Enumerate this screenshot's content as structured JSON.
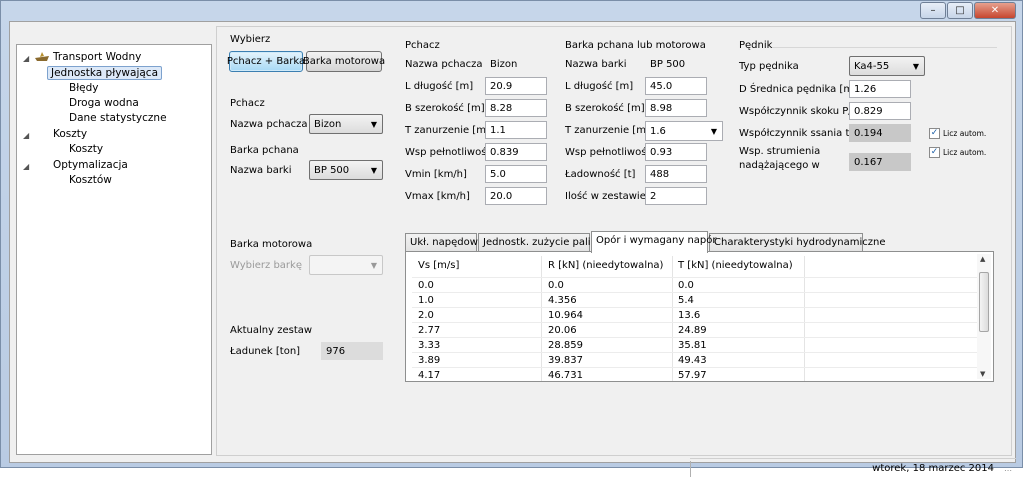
{
  "window": {
    "minimize_icon": "minimize-icon",
    "maximize_icon": "maximize-icon",
    "close_icon": "close-icon"
  },
  "tree": {
    "items": [
      {
        "label": "Transport Wodny",
        "level": 0,
        "expanded": true,
        "icon": "boat-icon"
      },
      {
        "label": "Jednostka pływająca",
        "level": 1,
        "selected": true
      },
      {
        "label": "Błędy",
        "level": 1
      },
      {
        "label": "Droga wodna",
        "level": 1
      },
      {
        "label": "Dane statystyczne",
        "level": 1
      },
      {
        "label": "Koszty",
        "level": 0,
        "expanded": true
      },
      {
        "label": "Koszty",
        "level": 1
      },
      {
        "label": "Optymalizacja",
        "level": 0,
        "expanded": true
      },
      {
        "label": "Kosztów",
        "level": 1
      }
    ]
  },
  "wybierz": {
    "title": "Wybierz",
    "btn_pchacz_barka": "Pchacz + Barka",
    "btn_barka_motorowa": "Barka motorowa"
  },
  "pchacz_select": {
    "title": "Pchacz",
    "label": "Nazwa pchacza",
    "value": "Bizon"
  },
  "barka_pchana_select": {
    "title": "Barka pchana",
    "label": "Nazwa barki",
    "value": "BP 500"
  },
  "barka_motorowa": {
    "title": "Barka motorowa",
    "placeholder": "Wybierz barkę",
    "value": ""
  },
  "aktualny_zestaw": {
    "title": "Aktualny zestaw",
    "label": "Ładunek [ton]",
    "value": "976"
  },
  "pchacz": {
    "title": "Pchacz",
    "fields": [
      {
        "label": "Nazwa pchacza",
        "value": "Bizon"
      },
      {
        "label": "L długość [m]",
        "value": "20.9"
      },
      {
        "label": "B szerokość [m]",
        "value": "8.28"
      },
      {
        "label": "T zanurzenie [m]",
        "value": "1.1"
      },
      {
        "label": "Wsp pełnotliwości",
        "value": "0.839"
      },
      {
        "label": "Vmin [km/h]",
        "value": "5.0"
      },
      {
        "label": "Vmax [km/h]",
        "value": "20.0"
      }
    ]
  },
  "barka": {
    "title": "Barka pchana lub motorowa",
    "fields": [
      {
        "label": "Nazwa barki",
        "value": "BP 500"
      },
      {
        "label": "L długość [m]",
        "value": "45.0"
      },
      {
        "label": "B szerokość [m]",
        "value": "8.98"
      },
      {
        "label": "T zanurzenie [m]",
        "value": "1.6"
      },
      {
        "label": "Wsp pełnotliwości",
        "value": "0.93"
      },
      {
        "label": "Ładowność [t]",
        "value": "488"
      },
      {
        "label": "Ilość w zestawie",
        "value": "2"
      }
    ]
  },
  "pednik": {
    "title": "Pędnik",
    "typ_label": "Typ pędnika",
    "typ_value": "Ka4-55",
    "srednica_label": "D Średnica pędnika [m]",
    "srednica_value": "1.26",
    "skok_label": "Współczynnik skoku P/D",
    "skok_value": "0.829",
    "ssania_label": "Współczynnik ssania t",
    "ssania_value": "0.194",
    "strum_label_1": "Wsp. strumienia",
    "strum_label_2": "nadążającego w",
    "strum_value": "0.167",
    "licz_autom": "Licz autom.",
    "licz_autom_1_checked": true,
    "licz_autom_2_checked": true
  },
  "tabs": [
    {
      "label": "Ukł. napędowy"
    },
    {
      "label": "Jednostk. zużycie paliwa"
    },
    {
      "label": "Opór i wymagany napór",
      "active": true
    },
    {
      "label": "Charakterystyki hydrodynamiczne"
    }
  ],
  "table": {
    "headers": [
      "Vs [m/s]",
      "R [kN] (nieedytowalna)",
      "T [kN] (nieedytowalna)"
    ],
    "rows": [
      [
        "0.0",
        "0.0",
        "0.0"
      ],
      [
        "1.0",
        "4.356",
        "5.4"
      ],
      [
        "2.0",
        "10.964",
        "13.6"
      ],
      [
        "2.77",
        "20.06",
        "24.89"
      ],
      [
        "3.33",
        "28.859",
        "35.81"
      ],
      [
        "3.89",
        "39.837",
        "49.43"
      ],
      [
        "4.17",
        "46.731",
        "57.97"
      ]
    ]
  },
  "status": {
    "date": "wtorek, 18 marzec 2014"
  }
}
